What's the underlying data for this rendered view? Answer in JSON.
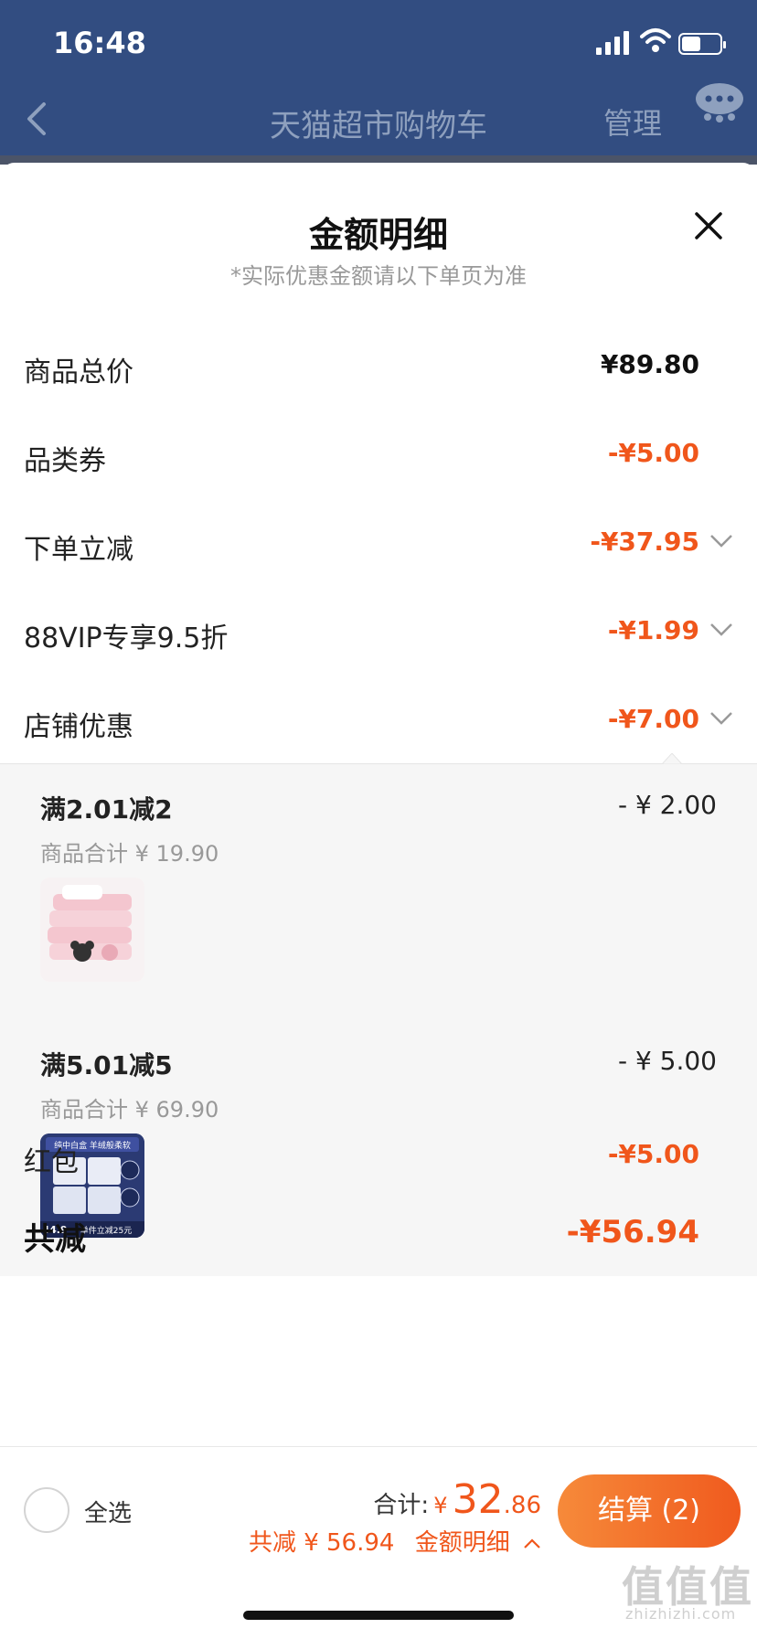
{
  "status_bar": {
    "time": "16:48"
  },
  "nav": {
    "title": "天猫超市购物车",
    "manage": "管理"
  },
  "sheet": {
    "title": "金额明细",
    "subtitle": "*实际优惠金额请以下单页为准"
  },
  "rows": [
    {
      "label": "商品总价",
      "value": "¥89.80"
    },
    {
      "label": "品类券",
      "value": "-¥5.00"
    },
    {
      "label": "下单立减",
      "value": "-¥37.95"
    },
    {
      "label": "88VIP专享9.5折",
      "value": "-¥1.99"
    },
    {
      "label": "店铺优惠",
      "value": "-¥7.00"
    }
  ],
  "store_details": [
    {
      "title": "满2.01减2",
      "amount": "- ¥ 2.00",
      "subtotal": "商品合计 ¥ 19.90"
    },
    {
      "title": "满5.01减5",
      "amount": "- ¥ 5.00",
      "subtotal": "商品合计 ¥ 69.90"
    }
  ],
  "thumb2": {
    "label_top": "纯中白盒 羊绒般柔软",
    "price_tag": "44.9",
    "promo": "单件立减25元"
  },
  "red_packet": {
    "label": "红包",
    "value": "-¥5.00"
  },
  "total": {
    "label": "共减",
    "value": "-¥56.94"
  },
  "bottom": {
    "select_all": "全选",
    "sum_label": "合计:",
    "yen": "¥",
    "sum_int": "32",
    "sum_dec": ".86",
    "saved": "共减 ¥ 56.94",
    "detail_link": "金额明细",
    "checkout": "结算 (2)"
  },
  "watermark": {
    "main": "值值值",
    "sub": "zhizhizhi.com"
  },
  "colors": {
    "nav_bg": "#324d81",
    "accent": "#f0561b"
  }
}
